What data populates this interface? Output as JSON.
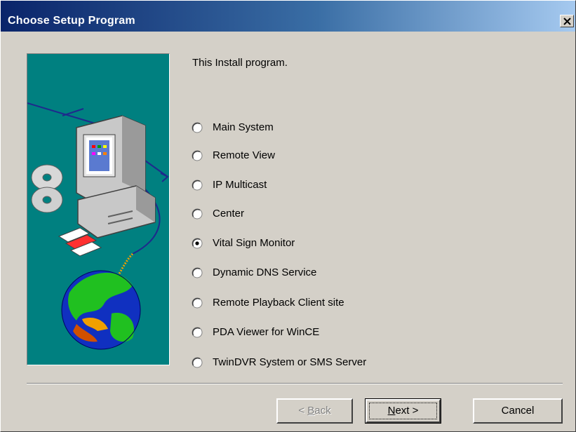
{
  "window": {
    "title": "Choose Setup Program"
  },
  "content": {
    "intro": "This Install program."
  },
  "options": [
    {
      "label": "Main System",
      "selected": false
    },
    {
      "label": "Remote View",
      "selected": false
    },
    {
      "label": "IP Multicast",
      "selected": false
    },
    {
      "label": "Center",
      "selected": false
    },
    {
      "label": "Vital Sign Monitor",
      "selected": true
    },
    {
      "label": "Dynamic DNS Service",
      "selected": false
    },
    {
      "label": "Remote Playback Client site",
      "selected": false
    },
    {
      "label": "PDA Viewer for WinCE",
      "selected": false
    },
    {
      "label": "TwinDVR System or SMS Server",
      "selected": false
    }
  ],
  "buttons": {
    "back": {
      "pre": "< ",
      "accel": "B",
      "post": "ack",
      "enabled": false
    },
    "next": {
      "accel": "N",
      "post": "ext >",
      "enabled": true
    },
    "cancel": {
      "label": "Cancel",
      "enabled": true
    }
  },
  "colors": {
    "title_start": "#0a246a",
    "title_end": "#a6caf0",
    "face": "#d4d0c8",
    "picture_bg": "#008080"
  },
  "icons": {
    "close": "close-icon",
    "picture": "computer-globe-illustration"
  }
}
